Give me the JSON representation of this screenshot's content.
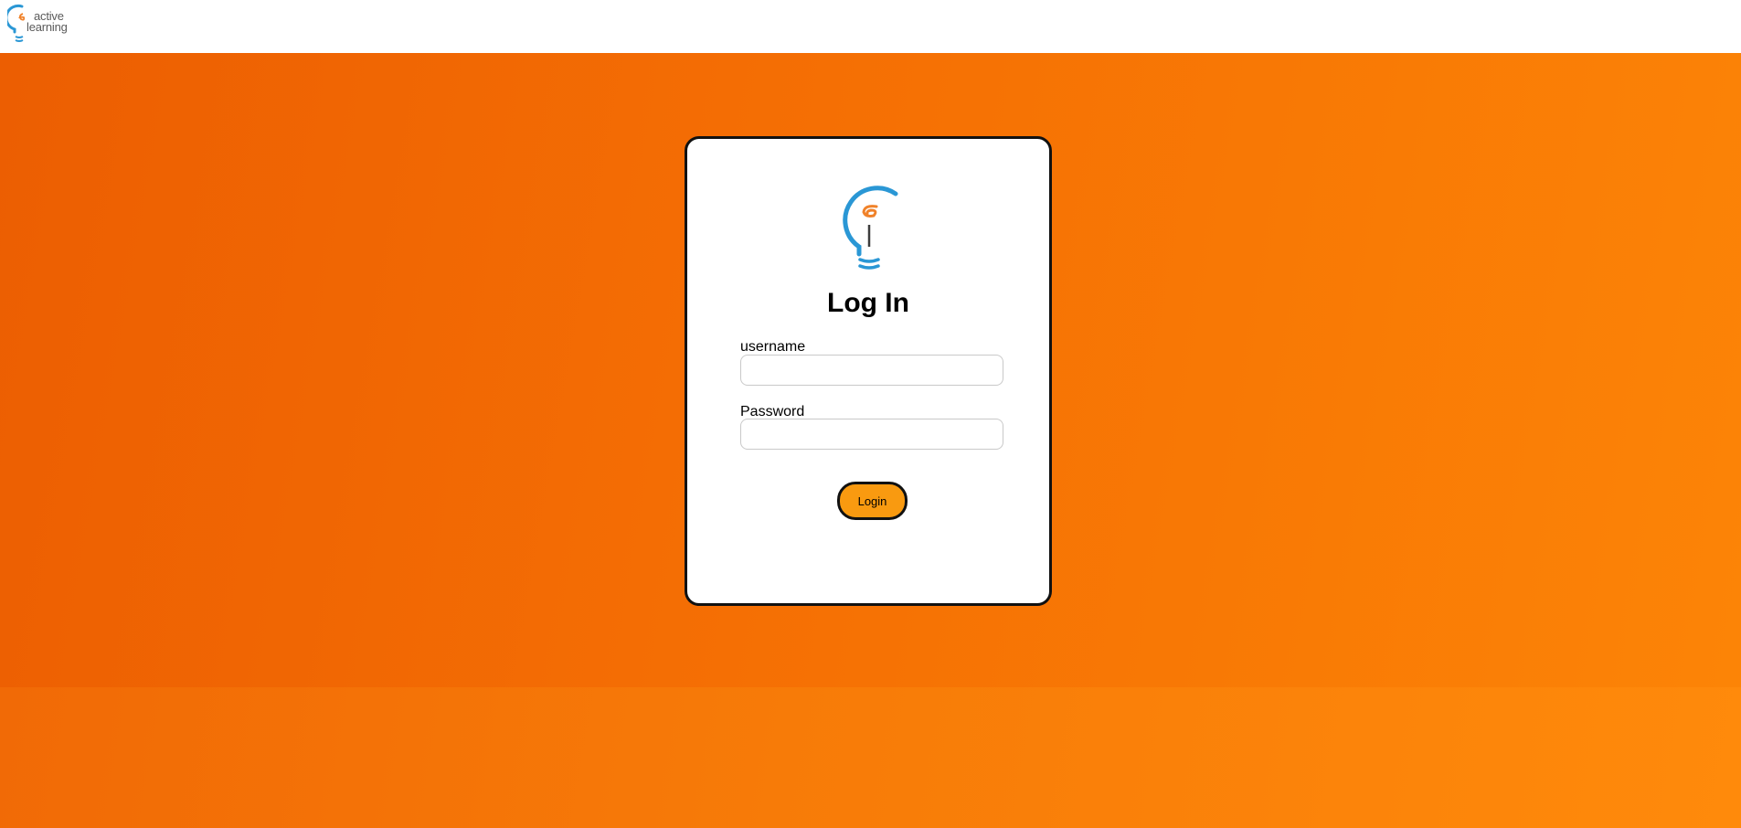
{
  "header": {
    "brand_line1": "active",
    "brand_line2": "learning",
    "logo_icon": "lightbulb-icon"
  },
  "login": {
    "title": "Log In",
    "username_label": "username",
    "username_value": "",
    "password_label": "Password",
    "password_value": "",
    "submit_label": "Login",
    "logo_icon": "lightbulb-icon"
  },
  "colors": {
    "primary_orange": "#f06a05",
    "button_orange": "#f99a10",
    "bulb_blue": "#2a97d5",
    "filament_orange": "#f0822a",
    "text_gray": "#5a5a5a"
  }
}
